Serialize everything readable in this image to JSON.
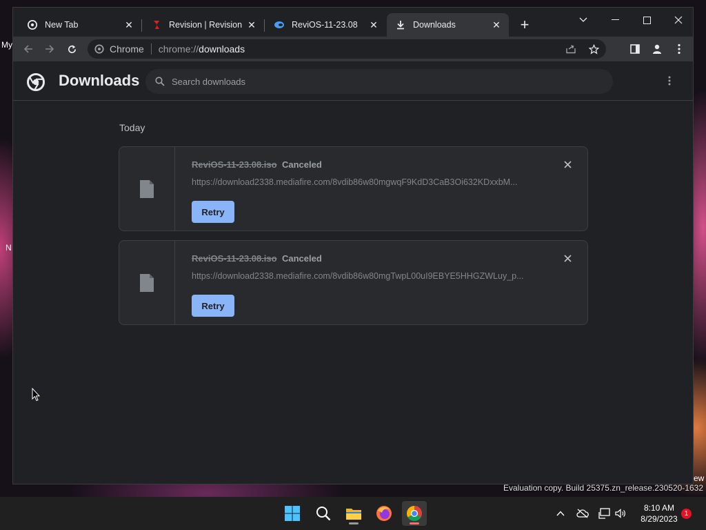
{
  "desktop": {
    "fragments": [
      "My",
      "N",
      "ew"
    ],
    "watermark": "Evaluation copy. Build 25375.zn_release.230520-1632"
  },
  "tabs": [
    {
      "title": "New Tab",
      "icon": "chrome-icon",
      "active": false
    },
    {
      "title": "Revision | Revision",
      "icon": "revision-logo-icon",
      "active": false
    },
    {
      "title": "ReviOS-11-23.08",
      "icon": "revios-logo-icon",
      "active": false
    },
    {
      "title": "Downloads",
      "icon": "download-icon",
      "active": true
    }
  ],
  "omnibox": {
    "site_chip": "Chrome",
    "url_scheme": "chrome://",
    "url_path": "downloads"
  },
  "page": {
    "title": "Downloads",
    "search_placeholder": "Search downloads",
    "section_label": "Today"
  },
  "downloads": [
    {
      "filename": "ReviOS-11-23.08.iso",
      "status": "Canceled",
      "url": "https://download2338.mediafire.com/8vdib86w80mgwqF9KdD3CaB3Oi632KDxxbM...",
      "action": "Retry"
    },
    {
      "filename": "ReviOS-11-23.08.iso",
      "status": "Canceled",
      "url": "https://download2338.mediafire.com/8vdib86w80mgTwpL00uI9EBYE5HHGZWLuy_p...",
      "action": "Retry"
    }
  ],
  "taskbar": {
    "apps": [
      "windows-start-icon",
      "search-icon",
      "file-explorer-icon",
      "firefox-icon",
      "chrome-icon"
    ],
    "clock_time": "8:10 AM",
    "clock_date": "8/29/2023",
    "notification_count": "1"
  },
  "colors": {
    "accent": "#8ab4f8",
    "window_bg": "#202124",
    "card_bg": "#292a2d"
  }
}
